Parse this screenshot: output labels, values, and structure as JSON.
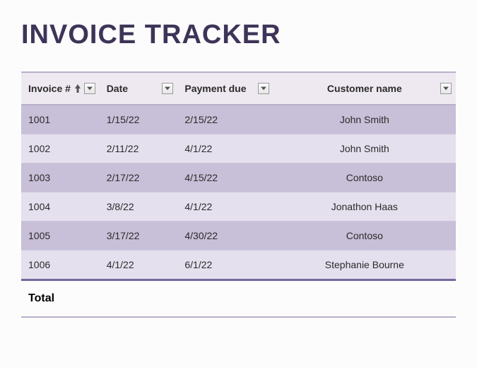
{
  "title": "INVOICE TRACKER",
  "headers": {
    "invoice": "Invoice #",
    "date": "Date",
    "payment_due": "Payment due",
    "customer": "Customer name"
  },
  "rows": [
    {
      "invoice": "1001",
      "date": "1/15/22",
      "payment_due": "2/15/22",
      "customer": "John Smith"
    },
    {
      "invoice": "1002",
      "date": "2/11/22",
      "payment_due": "4/1/22",
      "customer": "John Smith"
    },
    {
      "invoice": "1003",
      "date": "2/17/22",
      "payment_due": "4/15/22",
      "customer": "Contoso"
    },
    {
      "invoice": "1004",
      "date": "3/8/22",
      "payment_due": "4/1/22",
      "customer": "Jonathon Haas"
    },
    {
      "invoice": "1005",
      "date": "3/17/22",
      "payment_due": "4/30/22",
      "customer": "Contoso"
    },
    {
      "invoice": "1006",
      "date": "4/1/22",
      "payment_due": "6/1/22",
      "customer": "Stephanie Bourne"
    }
  ],
  "footer": {
    "label": "Total"
  }
}
